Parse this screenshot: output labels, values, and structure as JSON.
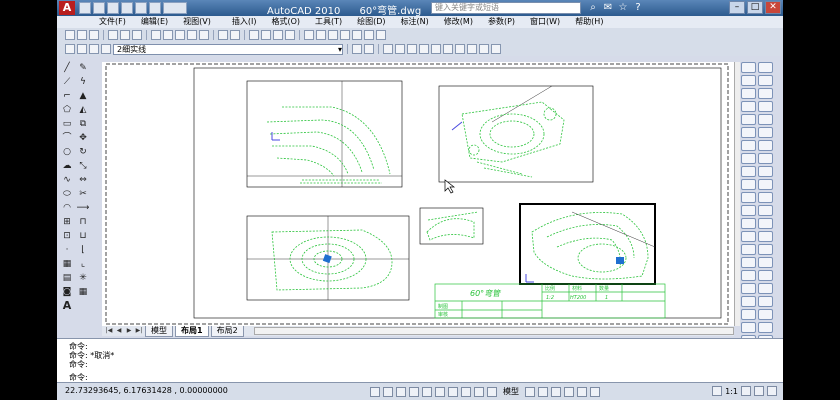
{
  "title_bar": {
    "app_name": "AutoCAD 2010",
    "file_name": "60°弯管.dwg",
    "search_placeholder": "键入关键字或短语"
  },
  "menu": [
    "文件(F)",
    "编辑(E)",
    "视图(V)",
    "插入(I)",
    "格式(O)",
    "工具(T)",
    "绘图(D)",
    "标注(N)",
    "修改(M)",
    "参数(P)",
    "窗口(W)",
    "帮助(H)"
  ],
  "layer_toolbar": {
    "layer_value": "2细实线"
  },
  "drawing": {
    "title_block": {
      "part_name": "60°弯管",
      "scale_label": "比例",
      "material_label": "材料",
      "qty_label": "数量",
      "scale_value": "1:2",
      "material_value": "HT200",
      "qty_value": "1",
      "drawn_label": "制图",
      "checked_label": "审核"
    }
  },
  "layout_tabs": [
    "模型",
    "布局1",
    "布局2"
  ],
  "command": {
    "lines": [
      "命令:",
      "命令: *取消*",
      "命令:"
    ],
    "prompt": "命令:"
  },
  "status": {
    "coordinates": "22.73293645,  6.17631428 , 0.00000000",
    "model_label": "模型",
    "scale": "1:1"
  },
  "accent": {
    "drawing_line_color": "#2ac33b",
    "title_bar_color": "#2c5a8e"
  }
}
